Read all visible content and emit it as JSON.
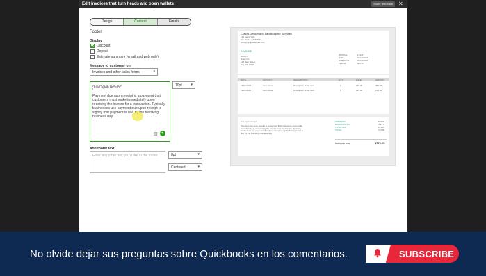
{
  "window": {
    "title": "Edit invoices that turn heads and open wallets",
    "feedback_label": "Share feedback",
    "close_glyph": "✕"
  },
  "tabs": [
    {
      "label": "Design",
      "active": false
    },
    {
      "label": "Content",
      "active": true
    },
    {
      "label": "Emails",
      "active": false
    }
  ],
  "section_title": "Footer",
  "display": {
    "label": "Display",
    "options": [
      {
        "label": "Discount",
        "checked": true
      },
      {
        "label": "Deposit",
        "checked": false
      },
      {
        "label": "Estimate summary (email and web only)",
        "checked": false
      }
    ]
  },
  "message": {
    "label": "Message to customer on",
    "selected": "Invoices and other sales forms",
    "font_size": "10pt",
    "title_text": "Due upon receipt:",
    "body_text": "Payment due upon receipt is a payment that customers must make immediately upon receiving the invoice for a transaction. Typically, businesses use payment due upon receipt to signify that payment is due by the following business day."
  },
  "footer_text": {
    "label": "Add footer text",
    "placeholder": "Enter any other text you'd like in the footer.",
    "font_size": "8pt",
    "alignment": "Centered"
  },
  "preview": {
    "company_name": "Craig's Design and Landscaping Services",
    "company_line1": "123 Sierra Way",
    "company_line2": "San Pablo, CA 87999",
    "company_email": "noreply@quickbooks.com",
    "invoice_word": "INVOICE",
    "bill_to_label": "BILL TO",
    "bill_to_name": "Smith Co.",
    "bill_to_addr1": "123 Main Street",
    "bill_to_addr2": "City, CA 12345",
    "meta_labels": [
      "INVOICE",
      "DATE",
      "DUE DATE",
      "TERMS"
    ],
    "meta_values": [
      "12345",
      "01/12/2018",
      "02/12/2018",
      "Net 30"
    ],
    "table_headers": [
      "DATE",
      "ACTIVITY",
      "DESCRIPTION",
      "QTY",
      "RATE",
      "AMOUNT"
    ],
    "rows": [
      [
        "12/01/2018",
        "Item name",
        "Description of the item",
        "2",
        "225.00",
        "450.00"
      ],
      [
        "12/01/2018",
        "Item name",
        "Description of the item",
        "1",
        "225.00",
        "225.00"
      ]
    ],
    "footer_title": "Due upon receipt:",
    "footer_body": "Payment due upon receipt is a payment that customers must make immediately upon receiving the invoice for a transaction. Typically, businesses use payment due upon receipt to signify that payment is due by the following business day.",
    "totals_labels": [
      "SUBTOTAL",
      "DISCOUNT 5%",
      "TOTAL TAX",
      "TOTAL"
    ],
    "totals_values": [
      "675.00",
      "-33.75",
      "101.25",
      "742.50"
    ],
    "balance_label": "BALANCE DUE",
    "balance_value": "$776.25"
  },
  "banner": {
    "text": "No olvide dejar sus preguntas sobre Quickbooks en los comentarios.",
    "subscribe_label": "SUBSCRIBE"
  },
  "colors": {
    "accent_green": "#2ca01c",
    "banner_navy": "#0f2a52",
    "subscribe_red": "#e8273a"
  }
}
